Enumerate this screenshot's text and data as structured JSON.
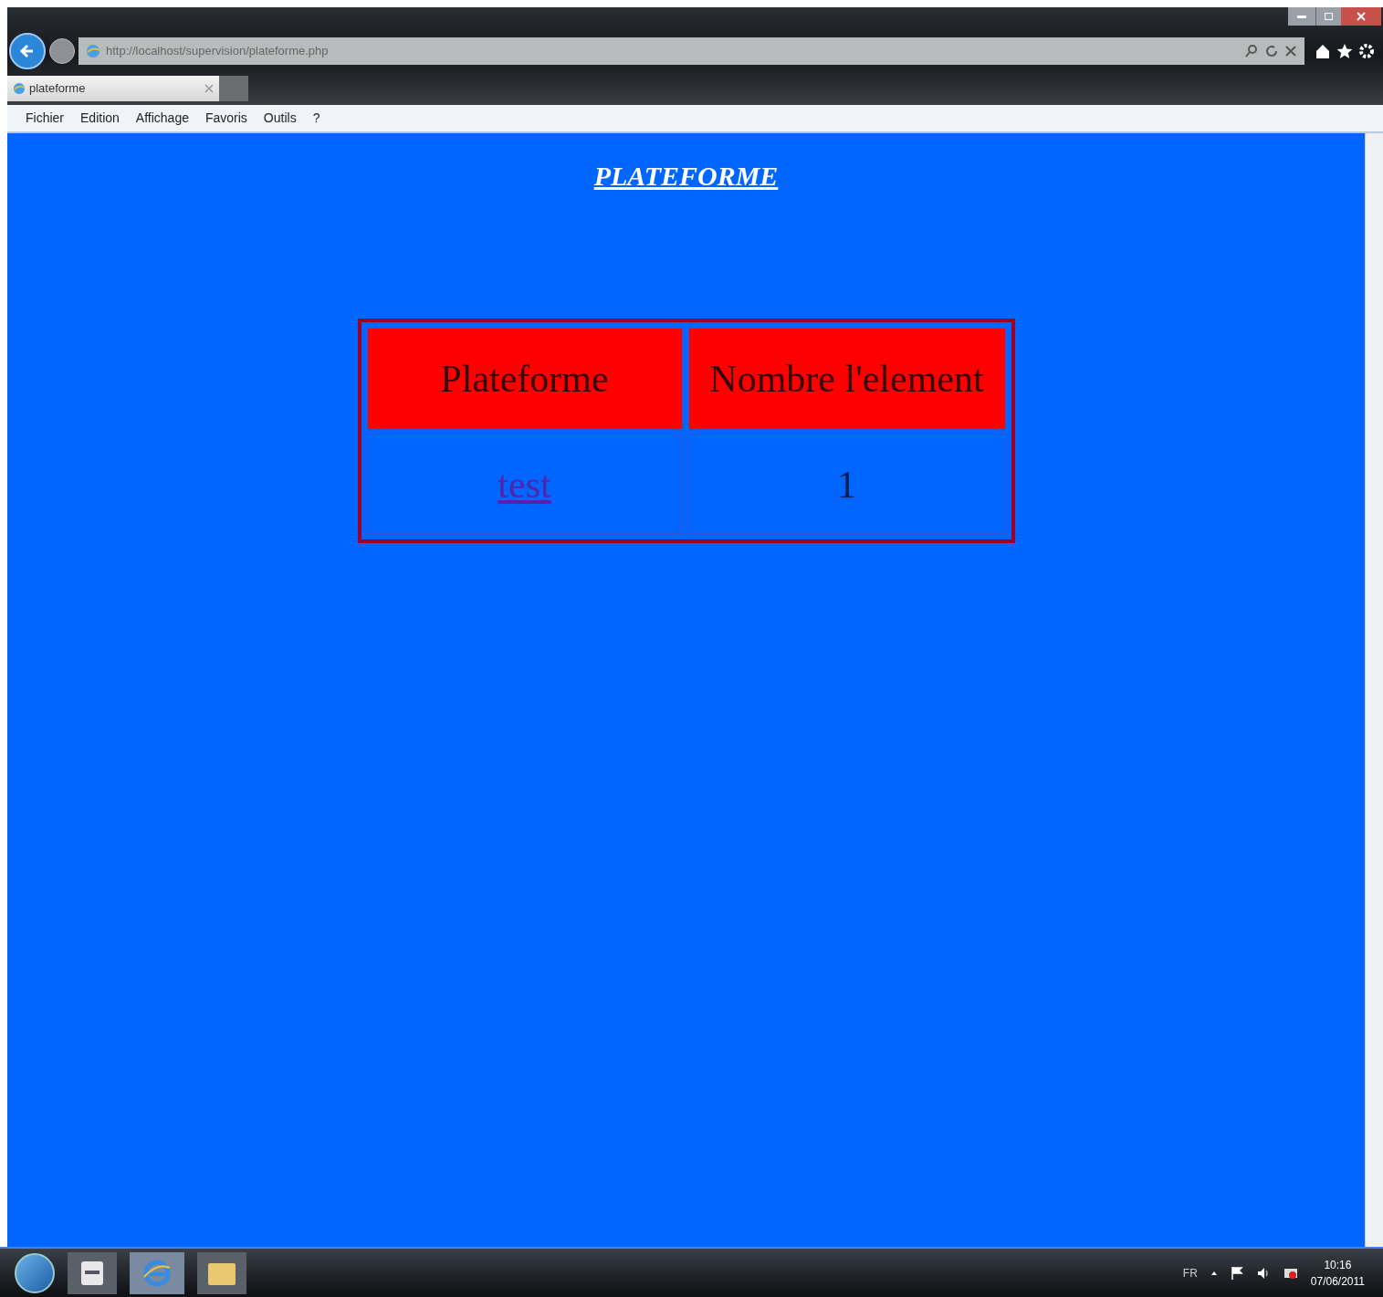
{
  "browser": {
    "address": "http://localhost/supervision/plateforme.php",
    "tab_title": "plateforme",
    "menu": [
      "Fichier",
      "Edition",
      "Affichage",
      "Favoris",
      "Outils",
      "?"
    ]
  },
  "page": {
    "heading": "PLATEFORME",
    "table": {
      "columns": [
        "Plateforme",
        "Nombre l'element"
      ],
      "rows": [
        [
          {
            "text": "test",
            "kind": "link"
          },
          {
            "text": "1",
            "kind": "text"
          }
        ]
      ]
    }
  },
  "taskbar": {
    "language": "FR",
    "time": "10:16",
    "date": "07/06/2011"
  }
}
